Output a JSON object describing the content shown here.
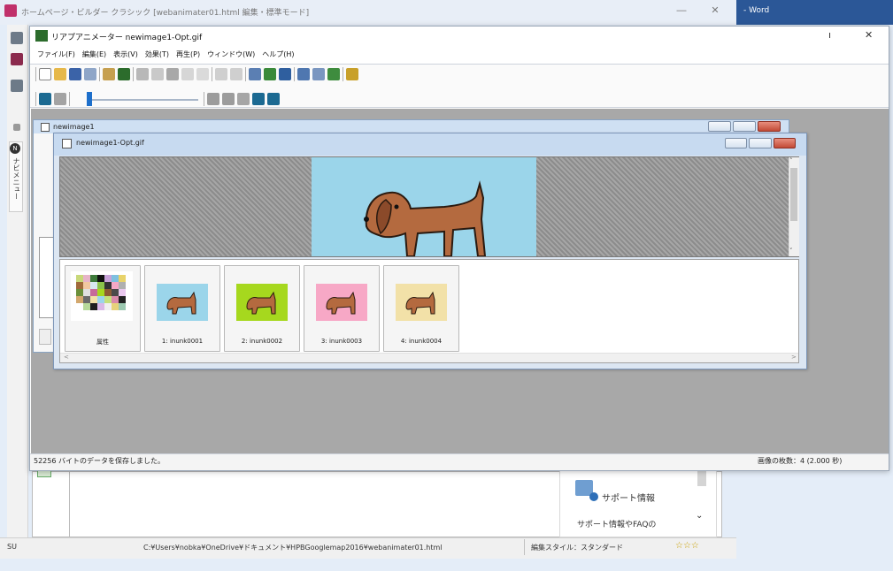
{
  "background_window": {
    "title": "ホームページ・ビルダー クラシック  [webanimater01.html  編集・標準モード]",
    "minimize": "―",
    "close": "✕",
    "word_title": "- Word",
    "left_tab_badge": "N",
    "left_tab_label": "ナビメニュー",
    "support_title": "サポート情報",
    "support_sub": "サポート情報やFAQの",
    "support_chevron": "⌄",
    "status": {
      "left": "SU",
      "path": "C:¥Users¥nobka¥OneDrive¥ドキュメント¥HPBGooglemap2016¥webanimater01.html",
      "style": "編集スタイル：スタンダード",
      "rating": "☆☆☆"
    }
  },
  "animator": {
    "title": "リアプアニメーター  newimage1-Opt.gif",
    "minimize": "ı",
    "close": "✕",
    "menu": [
      "ファイル(F)",
      "編集(E)",
      "表示(V)",
      "効果(T)",
      "再生(P)",
      "ウィンドウ(W)",
      "ヘルプ(H)"
    ],
    "status_message": "52256 バイトのデータを保存しました。",
    "status_frames": "画像の枚数：4 (2.000 秒)"
  },
  "win_newimage1": {
    "title": "newimage1"
  },
  "win_opt": {
    "title": "newimage1-Opt.gif",
    "scroll_up": "˄",
    "scroll_down": "˅",
    "hscroll_left": "<",
    "hscroll_right": ">",
    "frames": [
      {
        "label": "属性",
        "thumb": "mosaic"
      },
      {
        "label": "1: inunk0001",
        "bg": "#9bd5ea"
      },
      {
        "label": "2: inunk0002",
        "bg": "#a6d81e"
      },
      {
        "label": "3: inunk0003",
        "bg": "#f7a8c6"
      },
      {
        "label": "4: inunk0004",
        "bg": "#f2e1a8"
      }
    ]
  },
  "icons": {
    "toolbar_row1": [
      "new-file-icon",
      "open-folder-icon",
      "save-icon",
      "save-as-icon",
      "undo-icon",
      "wizard-icon",
      "cut-icon",
      "copy-icon",
      "paste-icon",
      "delete-icon",
      "duplicate-icon",
      "rotate-left-icon",
      "rotate-right-icon",
      "properties-icon",
      "optimize-icon",
      "preview-icon",
      "effects-icon",
      "image-icon",
      "palette-icon",
      "edit-icon"
    ],
    "toolbar_row2": [
      "play-icon",
      "stop-icon",
      "pause-icon",
      "first-frame-icon",
      "prev-frame-icon",
      "next-frame-icon",
      "last-frame-icon"
    ]
  }
}
